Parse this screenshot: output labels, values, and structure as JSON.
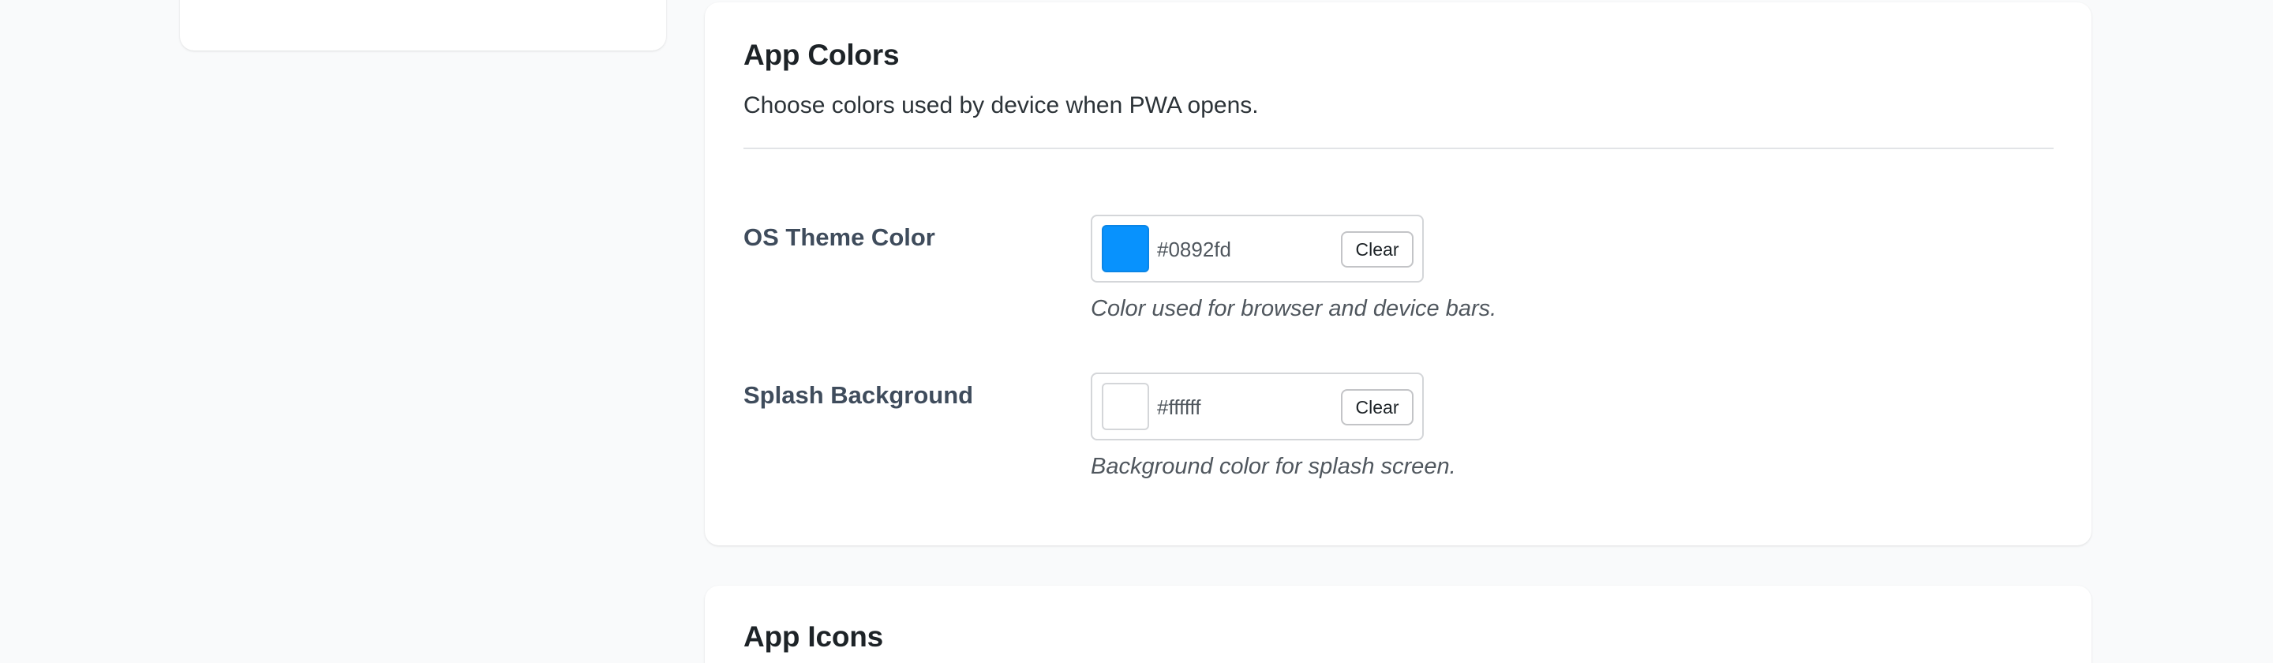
{
  "app_colors": {
    "title": "App Colors",
    "description": "Choose colors used by device when PWA opens.",
    "fields": [
      {
        "label": "OS Theme Color",
        "value": "#0892fd",
        "swatch_color": "#0892fd",
        "clear_label": "Clear",
        "help": "Color used for browser and device bars."
      },
      {
        "label": "Splash Background",
        "value": "#ffffff",
        "swatch_color": "#ffffff",
        "clear_label": "Clear",
        "help": "Background color for splash screen."
      }
    ]
  },
  "app_icons": {
    "title": "App Icons"
  }
}
